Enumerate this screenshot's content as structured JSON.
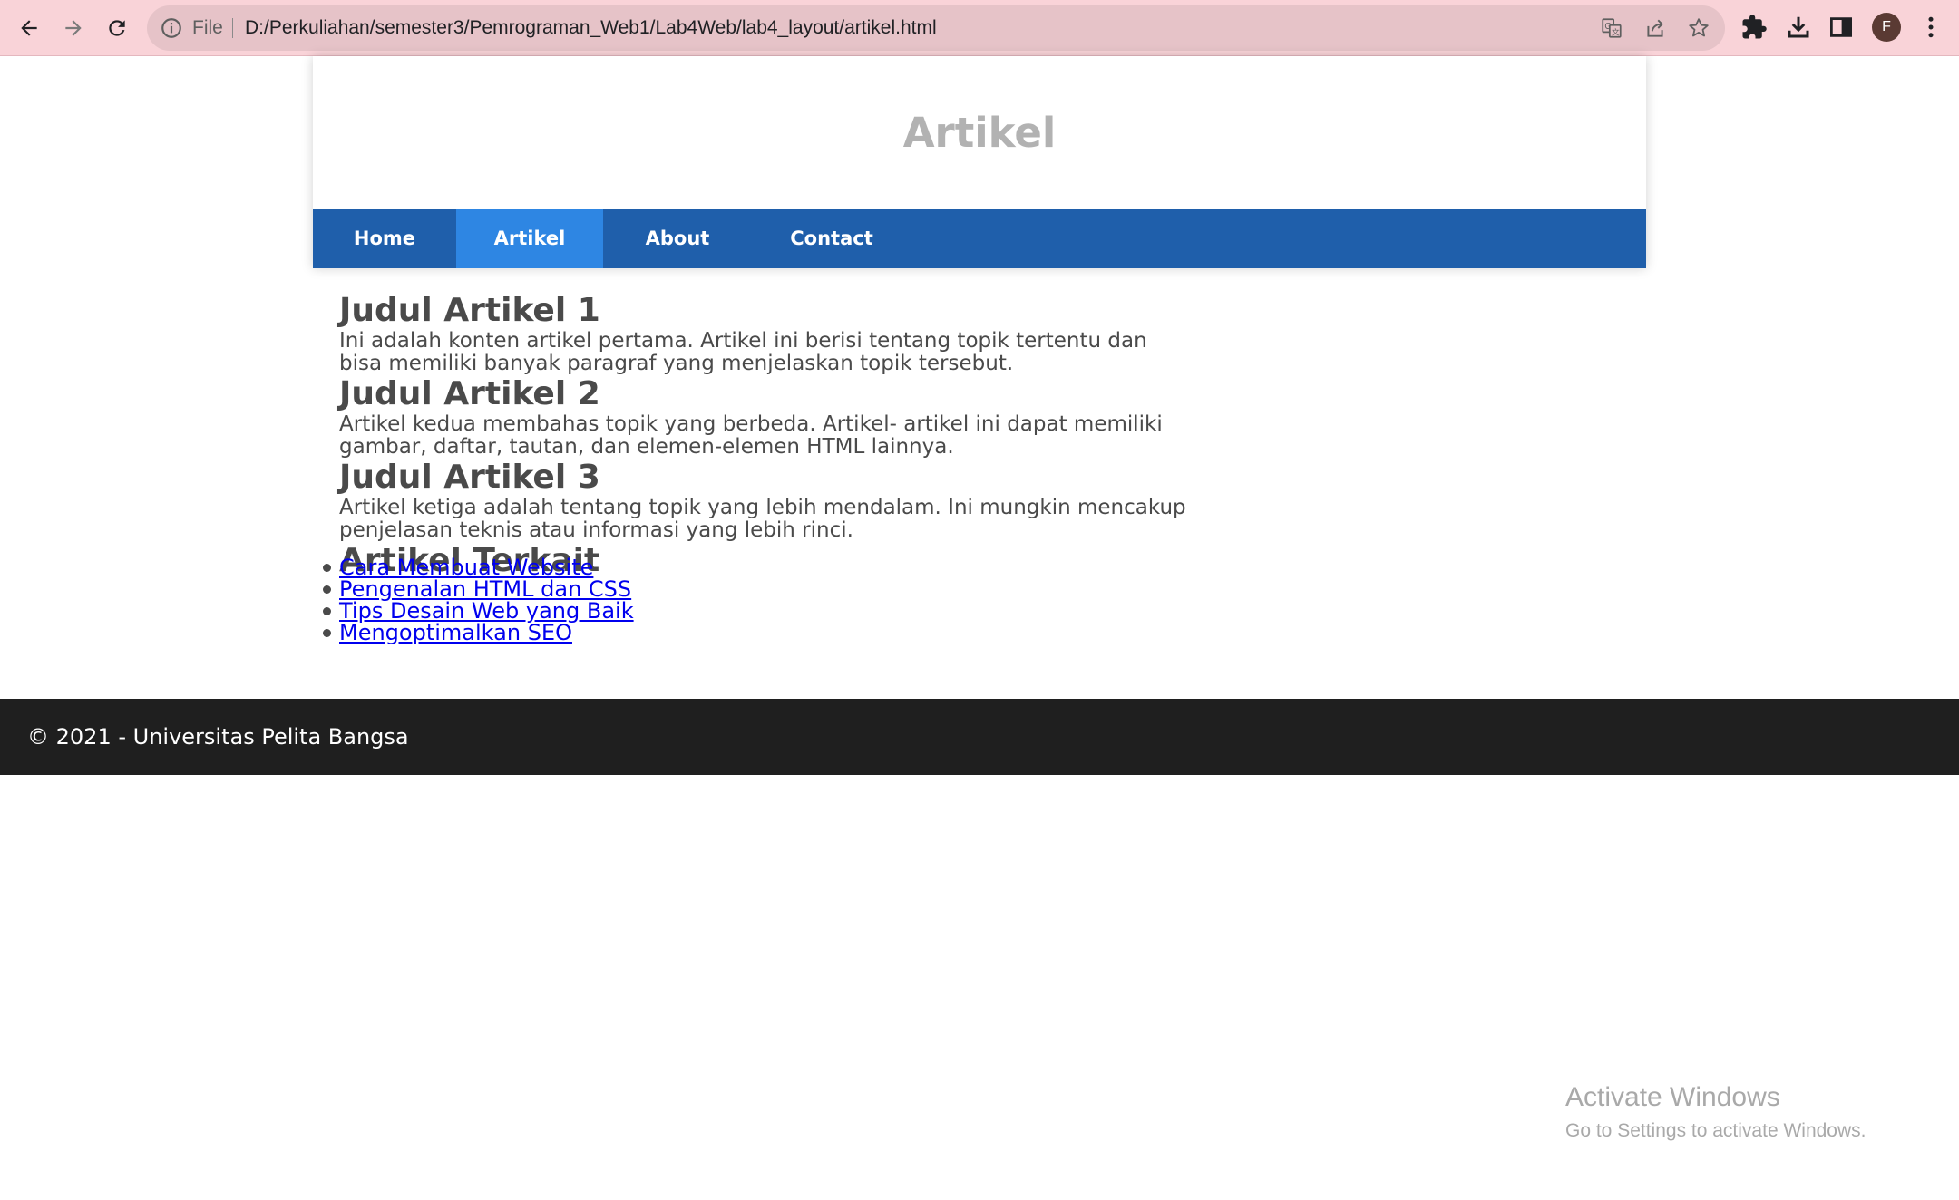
{
  "browser": {
    "omnibox_scheme_label": "File",
    "url": "D:/Perkuliahan/semester3/Pemrograman_Web1/Lab4Web/lab4_layout/artikel.html",
    "profile_initial": "F",
    "colors": {
      "frame": "#f9d3d8",
      "omnibox": "#e6c3c8"
    },
    "icons": [
      "back-icon",
      "forward-icon",
      "reload-icon",
      "info-icon",
      "translate-icon",
      "share-icon",
      "star-icon",
      "extensions-icon",
      "download-icon",
      "side-panel-icon",
      "menu-icon"
    ]
  },
  "header": {
    "title": "Artikel"
  },
  "nav": {
    "items": [
      {
        "label": "Home",
        "active": false
      },
      {
        "label": "Artikel",
        "active": true
      },
      {
        "label": "About",
        "active": false
      },
      {
        "label": "Contact",
        "active": false
      }
    ],
    "colors": {
      "bar": "#1f5fab",
      "active": "#2e86e3"
    }
  },
  "articles": [
    {
      "title": "Judul Artikel 1",
      "body": "Ini adalah konten artikel pertama. Artikel ini berisi tentang topik tertentu dan bisa memiliki banyak paragraf yang menjelaskan topik tersebut."
    },
    {
      "title": "Judul Artikel 2",
      "body": "Artikel kedua membahas topik yang berbeda. Artikel- artikel ini dapat memiliki gambar, daftar, tautan, dan elemen-elemen HTML lainnya."
    },
    {
      "title": "Judul Artikel 3",
      "body": "Artikel ketiga adalah tentang topik yang lebih mendalam. Ini mungkin mencakup penjelasan teknis atau informasi yang lebih rinci."
    }
  ],
  "related": {
    "title": "Artikel Terkait",
    "links": [
      "Cara Membuat Website",
      "Pengenalan HTML dan CSS",
      "Tips Desain Web yang Baik",
      "Mengoptimalkan SEO"
    ]
  },
  "footer": {
    "text": "© 2021 - Universitas Pelita Bangsa",
    "color": "#1f1f1f"
  },
  "os_watermark": {
    "line1": "Activate Windows",
    "line2": "Go to Settings to activate Windows."
  }
}
